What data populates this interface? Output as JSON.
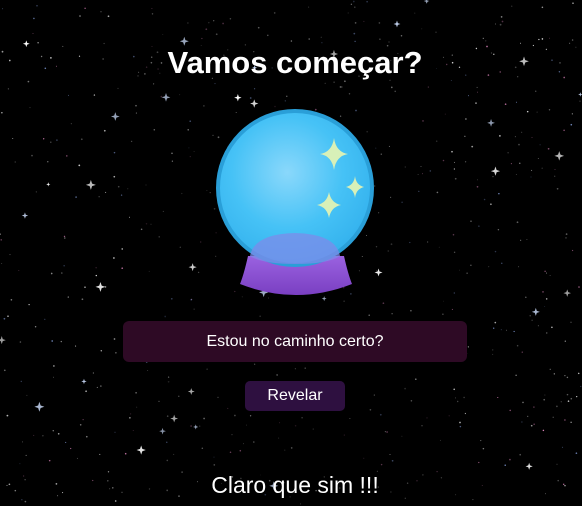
{
  "page": {
    "title": "Vamos começar?"
  },
  "crystal_ball": {
    "icon": "crystal-ball-icon",
    "glass_color": "#3bbdf5",
    "glass_rim_color": "#2a9fd8",
    "base_color": "#8a4fd0",
    "sparkle_color": "#d8f0b8"
  },
  "question": {
    "value": "Estou no caminho certo?",
    "background": "#2e0a25"
  },
  "reveal_button": {
    "label": "Revelar",
    "background": "#2e1040"
  },
  "answer": {
    "text": "Claro que sim !!!"
  },
  "background": {
    "color": "#000000",
    "decoration": "starfield"
  }
}
